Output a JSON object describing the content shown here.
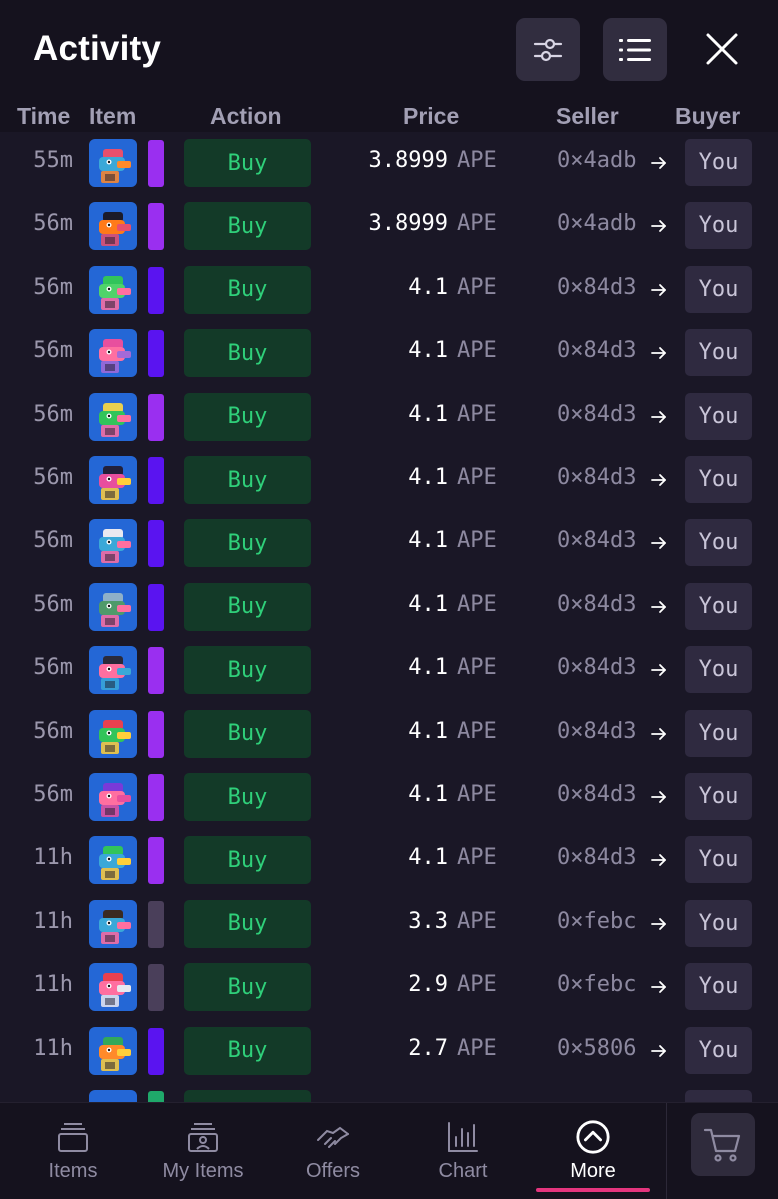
{
  "header": {
    "title": "Activity"
  },
  "columns": {
    "time": "Time",
    "item": "Item",
    "action": "Action",
    "price": "Price",
    "seller": "Seller",
    "buyer": "Buyer"
  },
  "rows": [
    {
      "time": "55m",
      "action": "Buy",
      "price": "3.8999",
      "currency": "APE",
      "seller": "0×4adb",
      "buyer": "You",
      "rarity_color": "#9a2ff0",
      "thumb_colors": [
        "#2467d6",
        "#e84f6c",
        "#3aa8d8",
        "#ff8a2a"
      ]
    },
    {
      "time": "56m",
      "action": "Buy",
      "price": "3.8999",
      "currency": "APE",
      "seller": "0×4adb",
      "buyer": "You",
      "rarity_color": "#9a2ff0",
      "thumb_colors": [
        "#2467d6",
        "#1b1b2a",
        "#ff7a1a",
        "#e84f6c"
      ]
    },
    {
      "time": "56m",
      "action": "Buy",
      "price": "4.1",
      "currency": "APE",
      "seller": "0×84d3",
      "buyer": "You",
      "rarity_color": "#5a14f0",
      "thumb_colors": [
        "#2467d6",
        "#32c45a",
        "#4fd36a",
        "#ff6fa0"
      ]
    },
    {
      "time": "56m",
      "action": "Buy",
      "price": "4.1",
      "currency": "APE",
      "seller": "0×84d3",
      "buyer": "You",
      "rarity_color": "#5a14f0",
      "thumb_colors": [
        "#2467d6",
        "#e84f9e",
        "#ff6fa0",
        "#a36ad8"
      ]
    },
    {
      "time": "56m",
      "action": "Buy",
      "price": "4.1",
      "currency": "APE",
      "seller": "0×84d3",
      "buyer": "You",
      "rarity_color": "#9a2ff0",
      "thumb_colors": [
        "#2467d6",
        "#e8d04f",
        "#32c45a",
        "#ff6fa0"
      ]
    },
    {
      "time": "56m",
      "action": "Buy",
      "price": "4.1",
      "currency": "APE",
      "seller": "0×84d3",
      "buyer": "You",
      "rarity_color": "#5a14f0",
      "thumb_colors": [
        "#2467d6",
        "#22203a",
        "#e84f9e",
        "#ffcf3a"
      ]
    },
    {
      "time": "56m",
      "action": "Buy",
      "price": "4.1",
      "currency": "APE",
      "seller": "0×84d3",
      "buyer": "You",
      "rarity_color": "#5a14f0",
      "thumb_colors": [
        "#2467d6",
        "#e9e9f0",
        "#3aa8d8",
        "#ff6fa0"
      ]
    },
    {
      "time": "56m",
      "action": "Buy",
      "price": "4.1",
      "currency": "APE",
      "seller": "0×84d3",
      "buyer": "You",
      "rarity_color": "#5a14f0",
      "thumb_colors": [
        "#2467d6",
        "#8fb0c8",
        "#4f9a6a",
        "#ff6fa0"
      ]
    },
    {
      "time": "56m",
      "action": "Buy",
      "price": "4.1",
      "currency": "APE",
      "seller": "0×84d3",
      "buyer": "You",
      "rarity_color": "#9a2ff0",
      "thumb_colors": [
        "#2467d6",
        "#2a2a3a",
        "#ff6fa0",
        "#3aa8d8"
      ]
    },
    {
      "time": "56m",
      "action": "Buy",
      "price": "4.1",
      "currency": "APE",
      "seller": "0×84d3",
      "buyer": "You",
      "rarity_color": "#9a2ff0",
      "thumb_colors": [
        "#2467d6",
        "#e8404f",
        "#32c45a",
        "#ffcf3a"
      ]
    },
    {
      "time": "56m",
      "action": "Buy",
      "price": "4.1",
      "currency": "APE",
      "seller": "0×84d3",
      "buyer": "You",
      "rarity_color": "#9a2ff0",
      "thumb_colors": [
        "#2467d6",
        "#7a3ad8",
        "#ff6fa0",
        "#e84f9e"
      ]
    },
    {
      "time": "11h",
      "action": "Buy",
      "price": "4.1",
      "currency": "APE",
      "seller": "0×84d3",
      "buyer": "You",
      "rarity_color": "#9a2ff0",
      "thumb_colors": [
        "#2467d6",
        "#32c45a",
        "#3aa8d8",
        "#ffcf3a"
      ]
    },
    {
      "time": "11h",
      "action": "Buy",
      "price": "3.3",
      "currency": "APE",
      "seller": "0×febc",
      "buyer": "You",
      "rarity_color": "#4a3f5a",
      "thumb_colors": [
        "#2467d6",
        "#3a2a22",
        "#3aa8d8",
        "#ff6fa0"
      ]
    },
    {
      "time": "11h",
      "action": "Buy",
      "price": "2.9",
      "currency": "APE",
      "seller": "0×febc",
      "buyer": "You",
      "rarity_color": "#4a3f5a",
      "thumb_colors": [
        "#2467d6",
        "#e8404f",
        "#ff6fa0",
        "#e9e9f0"
      ]
    },
    {
      "time": "11h",
      "action": "Buy",
      "price": "2.7",
      "currency": "APE",
      "seller": "0×5806",
      "buyer": "You",
      "rarity_color": "#5a14f0",
      "thumb_colors": [
        "#2467d6",
        "#32a85a",
        "#ff8a2a",
        "#ffcf3a"
      ]
    },
    {
      "time": "",
      "action": "",
      "price": "",
      "currency": "",
      "seller": "",
      "buyer": "",
      "rarity_color": "#1fa86a",
      "thumb_colors": [
        "#2467d6",
        "#2467d6",
        "#2467d6",
        "#2467d6"
      ]
    }
  ],
  "tabs": [
    {
      "label": "Items",
      "icon": "stack-icon",
      "active": false
    },
    {
      "label": "My Items",
      "icon": "user-stack-icon",
      "active": false
    },
    {
      "label": "Offers",
      "icon": "handshake-icon",
      "active": false
    },
    {
      "label": "Chart",
      "icon": "bar-chart-icon",
      "active": false
    },
    {
      "label": "More",
      "icon": "chevron-up-circle-icon",
      "active": true
    }
  ],
  "colors": {
    "background": "#161320",
    "buy_text": "#2fd07a",
    "buy_bg": "#133a28",
    "active_underline": "#e4357e"
  }
}
